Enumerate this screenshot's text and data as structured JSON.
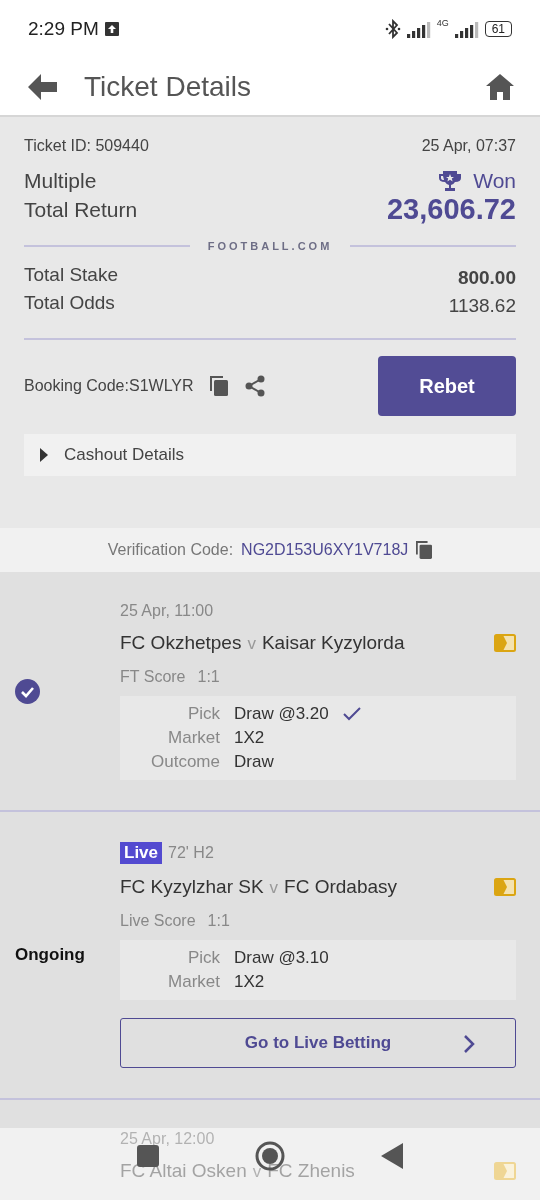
{
  "status_bar": {
    "time": "2:29 PM",
    "network": "4G",
    "battery": "61"
  },
  "header": {
    "title": "Ticket Details"
  },
  "ticket": {
    "id": "Ticket ID: 509440",
    "date": "25 Apr, 07:37",
    "type": "Multiple",
    "status": "Won",
    "return_label": "Total Return",
    "return_value": "23,606.72",
    "brand": "FOOTBALL.COM",
    "rows": [
      {
        "label": "Total Stake",
        "value": "800.00",
        "strong": true
      },
      {
        "label": "Total Odds",
        "value": "1138.62",
        "strong": false
      }
    ],
    "booking_code": "Booking Code:S1WLYR",
    "rebet": "Rebet",
    "cashout": {
      "label": "Cashout Details",
      "expanded": false
    }
  },
  "verification": {
    "label": "Verification Code:",
    "code": "NG2D153U6XY1V718J"
  },
  "matches": [
    {
      "kind": "settled",
      "won": true,
      "date": "25 Apr, 11:00",
      "home": "FC Okzhetpes",
      "sep": "v",
      "away": "Kaisar Kyzylorda",
      "score_label": "FT Score",
      "score": "1:1",
      "details": [
        {
          "label": "Pick",
          "value": "Draw @3.20",
          "correct": true
        },
        {
          "label": "Market",
          "value": "1X2",
          "correct": false
        },
        {
          "label": "Outcome",
          "value": "Draw",
          "correct": false
        }
      ]
    },
    {
      "kind": "live",
      "status": "Ongoing",
      "badge": "Live",
      "minute": "72' H2",
      "home": "FC Kyzylzhar SK",
      "sep": "v",
      "away": "FC Ordabasy",
      "score_label": "Live Score",
      "score": "1:1",
      "details": [
        {
          "label": "Pick",
          "value": "Draw @3.10",
          "correct": false
        },
        {
          "label": "Market",
          "value": "1X2",
          "correct": false
        }
      ],
      "button": "Go to Live Betting"
    },
    {
      "kind": "partial",
      "date": "25 Apr, 12:00",
      "home": "FC Altai Osken",
      "sep": "v",
      "away": "FC Zhenis"
    }
  ]
}
